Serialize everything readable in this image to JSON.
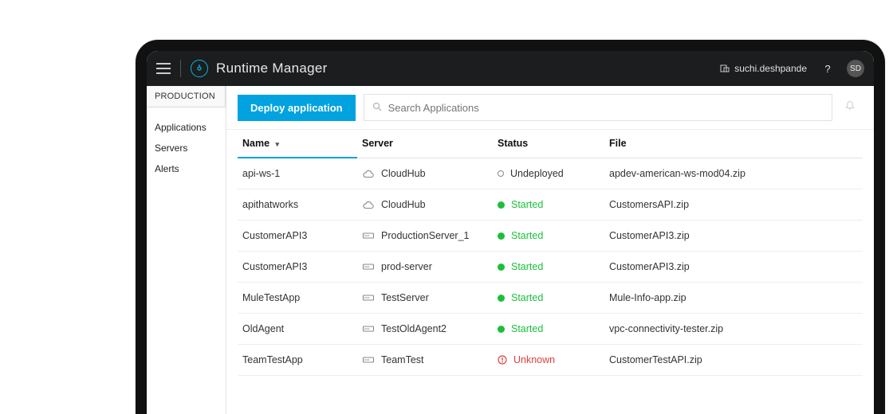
{
  "header": {
    "title": "Runtime Manager",
    "breadcrumb": "suchi.deshpande",
    "help_label": "?",
    "avatar_initials": "SD"
  },
  "sidebar": {
    "environment": "PRODUCTION",
    "items": [
      {
        "label": "Applications"
      },
      {
        "label": "Servers"
      },
      {
        "label": "Alerts"
      }
    ]
  },
  "toolbar": {
    "deploy_label": "Deploy application",
    "search_placeholder": "Search Applications"
  },
  "table": {
    "columns": {
      "name": "Name",
      "server": "Server",
      "status": "Status",
      "file": "File"
    },
    "rows": [
      {
        "name": "api-ws-1",
        "server": "CloudHub",
        "server_kind": "cloud",
        "status": "Undeployed",
        "status_kind": "undeployed",
        "file": "apdev-american-ws-mod04.zip"
      },
      {
        "name": "apithatworks",
        "server": "CloudHub",
        "server_kind": "cloud",
        "status": "Started",
        "status_kind": "started",
        "file": "CustomersAPI.zip"
      },
      {
        "name": "CustomerAPI3",
        "server": "ProductionServer_1",
        "server_kind": "onprem",
        "status": "Started",
        "status_kind": "started",
        "file": "CustomerAPI3.zip"
      },
      {
        "name": "CustomerAPI3",
        "server": "prod-server",
        "server_kind": "onprem",
        "status": "Started",
        "status_kind": "started",
        "file": "CustomerAPI3.zip"
      },
      {
        "name": "MuleTestApp",
        "server": "TestServer",
        "server_kind": "onprem",
        "status": "Started",
        "status_kind": "started",
        "file": "Mule-Info-app.zip"
      },
      {
        "name": "OldAgent",
        "server": "TestOldAgent2",
        "server_kind": "onprem",
        "status": "Started",
        "status_kind": "started",
        "file": "vpc-connectivity-tester.zip"
      },
      {
        "name": "TeamTestApp",
        "server": "TeamTest",
        "server_kind": "onprem",
        "status": "Unknown",
        "status_kind": "unknown",
        "file": "CustomerTestAPI.zip"
      }
    ]
  }
}
